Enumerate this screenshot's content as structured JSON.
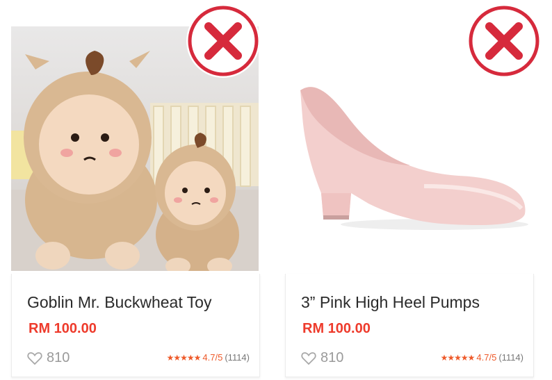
{
  "products": [
    {
      "title": "Goblin Mr. Buckwheat Toy",
      "price": "RM 100.00",
      "likes": "810",
      "stars": "★★★★★",
      "rating": "4.7/5",
      "reviews": "(1114)",
      "image_icon": "plush-toy-image",
      "status_icon": "red-x-icon"
    },
    {
      "title": "3” Pink High Heel Pumps",
      "price": "RM 100.00",
      "likes": "810",
      "stars": "★★★★★",
      "rating": "4.7/5",
      "reviews": "(1114)",
      "image_icon": "pink-high-heel-image",
      "status_icon": "red-x-icon"
    }
  ],
  "colors": {
    "price": "#ee3b2c",
    "x_mark": "#d62a3c",
    "stars": "#ee5a2a"
  }
}
